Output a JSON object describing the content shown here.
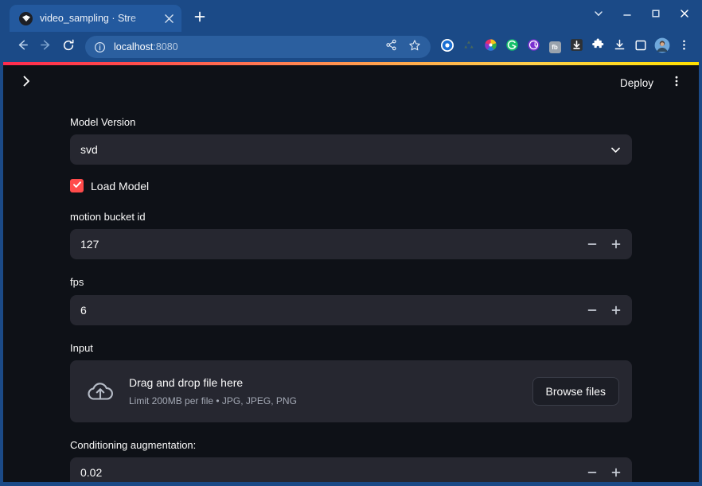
{
  "browser": {
    "tab": {
      "title": "video_sampling · Stre",
      "favicon_icon": "streamlit-favicon",
      "close_icon": "close-icon"
    },
    "new_tab_icon": "plus-icon",
    "window_controls": [
      {
        "name": "tab-search-button",
        "icon": "chevron-down-icon"
      },
      {
        "name": "minimize-button",
        "icon": "minimize-icon"
      },
      {
        "name": "maximize-button",
        "icon": "maximize-icon"
      },
      {
        "name": "close-window-button",
        "icon": "close-icon"
      }
    ],
    "nav": {
      "back_icon": "back-arrow-icon",
      "forward_icon": "forward-arrow-icon",
      "reload_icon": "reload-icon"
    },
    "omnibox": {
      "info_icon": "info-circle-icon",
      "url_host": "localhost",
      "url_port": ":8080",
      "share_icon": "share-icon",
      "bookmark_icon": "star-icon"
    },
    "extensions": [
      {
        "name": "extension-onepassword",
        "icon": "blue-circle-zero-icon",
        "label": "0"
      },
      {
        "name": "extension-recycle",
        "icon": "recycle-icon",
        "label": ""
      },
      {
        "name": "extension-color-wheel",
        "icon": "color-wheel-icon",
        "label": ""
      },
      {
        "name": "extension-grammarly",
        "icon": "green-g-icon",
        "label": "G"
      },
      {
        "name": "extension-purple",
        "icon": "purple-at-icon",
        "label": ""
      },
      {
        "name": "extension-facebook-container",
        "icon": "fb-square-icon",
        "label": "fb"
      },
      {
        "name": "extension-download-arrow",
        "icon": "dark-download-icon",
        "label": ""
      },
      {
        "name": "extensions-puzzle",
        "icon": "puzzle-piece-icon",
        "label": ""
      },
      {
        "name": "downloads-button",
        "icon": "download-tray-icon",
        "label": ""
      },
      {
        "name": "side-panel-button",
        "icon": "sidebar-square-icon",
        "label": ""
      },
      {
        "name": "profile-avatar",
        "icon": "avatar-icon",
        "label": ""
      },
      {
        "name": "browser-menu",
        "icon": "kebab-menu-icon",
        "label": ""
      }
    ]
  },
  "app": {
    "header": {
      "sidebar_toggle_icon": "chevron-right-icon",
      "deploy_label": "Deploy",
      "menu_icon": "kebab-menu-icon"
    },
    "accent_color": "#ff4b4b",
    "background_color": "#0e1117",
    "widget_background_color": "#262730",
    "fields": {
      "model_version": {
        "label": "Model Version",
        "value": "svd",
        "chevron_icon": "chevron-down-icon"
      },
      "load_model": {
        "label": "Load Model",
        "checked": true,
        "check_icon": "check-icon"
      },
      "motion_bucket_id": {
        "label": "motion bucket id",
        "value": "127",
        "decrement_icon": "minus-icon",
        "increment_icon": "plus-icon"
      },
      "fps": {
        "label": "fps",
        "value": "6",
        "decrement_icon": "minus-icon",
        "increment_icon": "plus-icon"
      },
      "input_uploader": {
        "label": "Input",
        "upload_icon": "cloud-upload-icon",
        "dropzone_text": "Drag and drop file here",
        "limit_text": "Limit 200MB per file • JPG, JPEG, PNG",
        "browse_label": "Browse files"
      },
      "conditioning_augmentation": {
        "label": "Conditioning augmentation:",
        "value": "0.02",
        "decrement_icon": "minus-icon",
        "increment_icon": "plus-icon"
      }
    }
  }
}
